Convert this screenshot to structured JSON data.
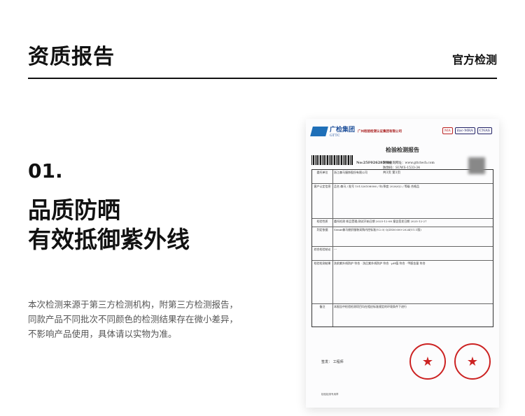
{
  "header": {
    "title": "资质报告",
    "subtitle": "官方检测"
  },
  "section": {
    "number": "01.",
    "headline_line1": "品质防晒",
    "headline_line2": "有效抵御紫外线",
    "description": [
      "本次检测来源于第三方检测机构，附第三方检测报告，",
      "同款产品不同批次不同颜色的检测结果存在微小差异，",
      "不影响产品使用，具体请以实物为准。"
    ]
  },
  "certificate": {
    "org": "广检集团",
    "org_en": "GTTC",
    "org_full": "广州检验检测认证集团有限公司",
    "badges": [
      "MA",
      "ilac-MRA",
      "CNAS"
    ],
    "title": "检验检测报告",
    "website": "防伪查询网址：www.gttctech.com",
    "code": "防伪码：SUWS-1533-34",
    "report_no": "No:25F026285M0",
    "pages": "共3页 第1页",
    "rows": [
      {
        "k": "委托单位",
        "v": "浙江森马服饰股份有限公司"
      },
      {
        "k": "客户认定信息",
        "v": "品名 森马 / 批号 101326108006 / 年/季度 2026/Q2 / 等级 合格品"
      },
      {
        "k": "检验性质",
        "v": "委托检测  样品受理/测试开始日期 2025-12-08  报告签发日期 2025-12-27"
      },
      {
        "k": "判定依据",
        "v": "Semir森马梭织服装采购内控标准(V2.0) Q/ZSM 600-2024(V1.1版)"
      },
      {
        "k": "综合检验结论",
        "v": "---"
      },
      {
        "k": "检验检测结果",
        "v": "洗前紫外线防护 符合 · 洗后紫外线防护 符合 · pH值 符合 · 甲醛含量 符合"
      },
      {
        "k": "备注",
        "v": "本报告中检验检测项目均在相应标准规定的环境条件下进行"
      }
    ],
    "signer": "签发：   工程师",
    "seal_text": "检验检测专用章"
  }
}
